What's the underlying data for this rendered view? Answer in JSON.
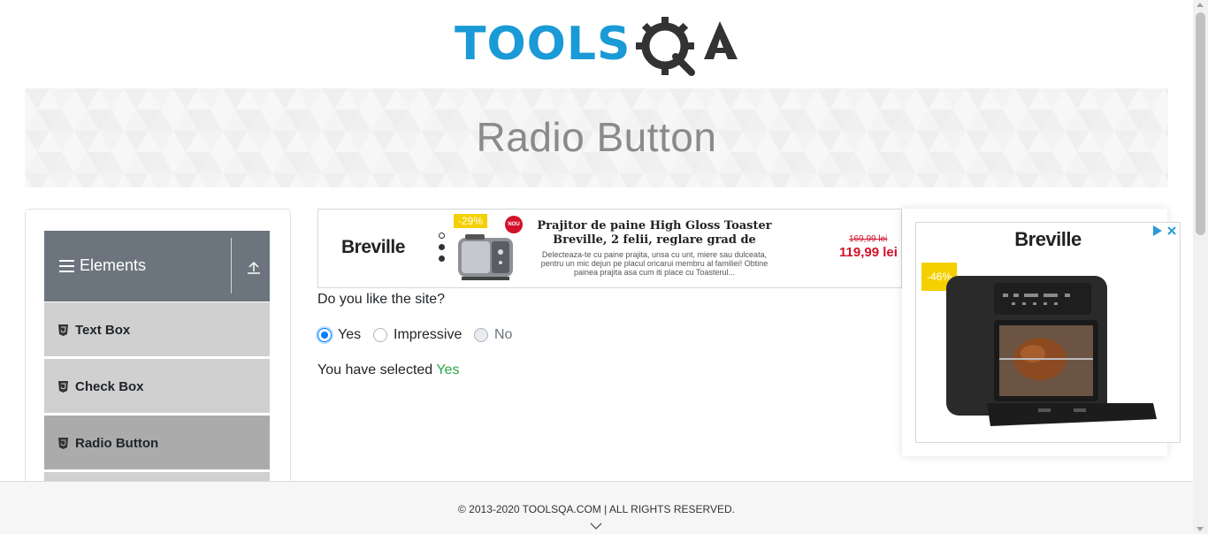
{
  "header": {
    "logo_text": "TOOLSQA",
    "logo_colors": {
      "tools": "#1a9ad6",
      "qa": "#333333"
    }
  },
  "banner": {
    "title": "Radio Button"
  },
  "sidebar": {
    "group_title": "Elements",
    "items": [
      {
        "label": "Text Box",
        "active": false
      },
      {
        "label": "Check Box",
        "active": false
      },
      {
        "label": "Radio Button",
        "active": true
      }
    ]
  },
  "ad_top": {
    "brand": "Breville",
    "discount": "-29%",
    "new_badge": "NOU",
    "headline": "Prajitor de paine High Gloss Toaster Breville, 2 felii, reglare grad de",
    "description": "Delecteaza-te cu paine prajita, unsa cu unt, miere sau dulceata, pentru un mic dejun pe placul oricarui membru al familiei! Obtine painea prajita asa cum iti place cu Toasterul...",
    "old_price": "169,99 lei",
    "new_price": "119,99 lei"
  },
  "form": {
    "question": "Do you like the site?",
    "options": [
      {
        "label": "Yes",
        "checked": true,
        "disabled": false
      },
      {
        "label": "Impressive",
        "checked": false,
        "disabled": false
      },
      {
        "label": "No",
        "checked": false,
        "disabled": true
      }
    ],
    "result_prefix": "You have selected",
    "result_value": "Yes"
  },
  "ad_right": {
    "brand": "Breville",
    "discount": "-46%"
  },
  "footer": {
    "copyright": "© 2013-2020 TOOLSQA.COM | ALL RIGHTS RESERVED."
  },
  "colors": {
    "accent": "#007bff",
    "success": "#28a745",
    "sidebar_header": "#6c757d",
    "price_red": "#d2112a",
    "badge_yellow": "#f5d000"
  }
}
